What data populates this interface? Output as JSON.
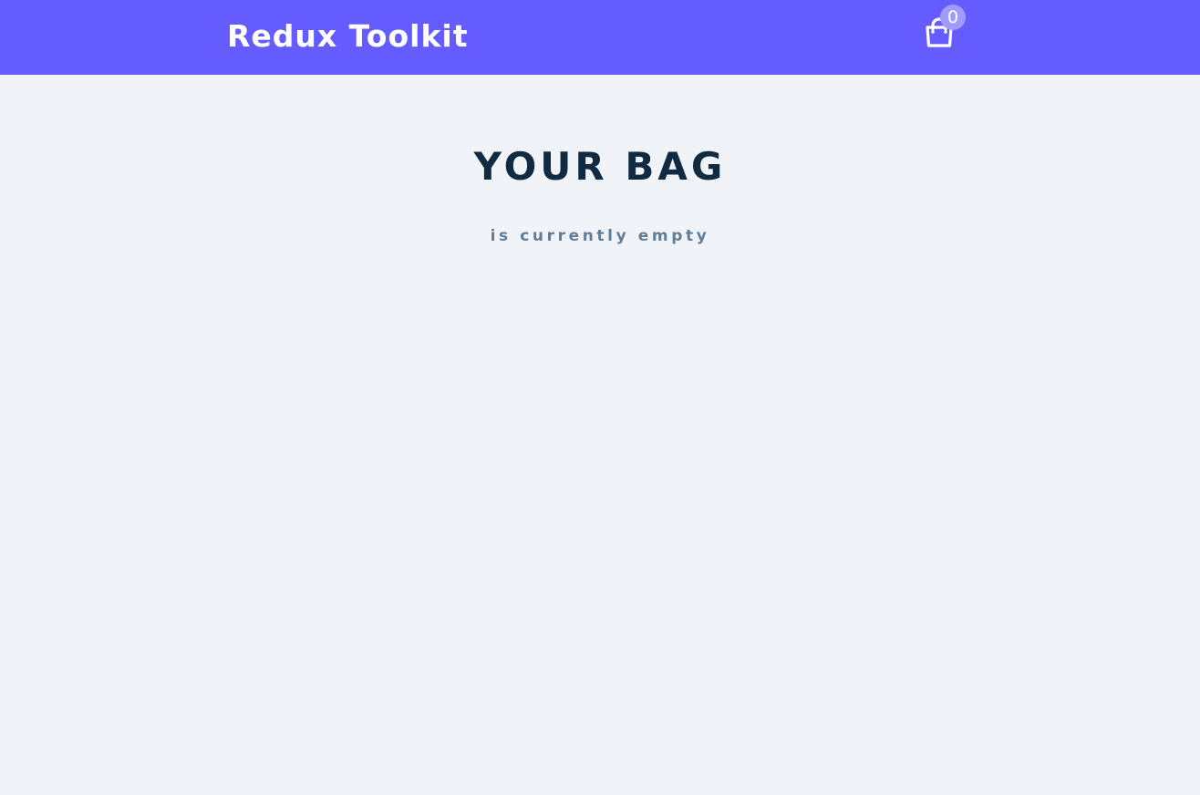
{
  "navbar": {
    "brand": "Redux Toolkit",
    "cart": {
      "icon": "shopping-bag-icon",
      "count": "0"
    }
  },
  "cart_section": {
    "title": "YOUR BAG",
    "empty_message": "is currently empty"
  },
  "colors": {
    "navbar_bg": "#645cff",
    "page_bg": "#f0f4f8",
    "title": "#102a42",
    "subtitle": "#617d98",
    "badge_bg": "#a29bfe"
  }
}
